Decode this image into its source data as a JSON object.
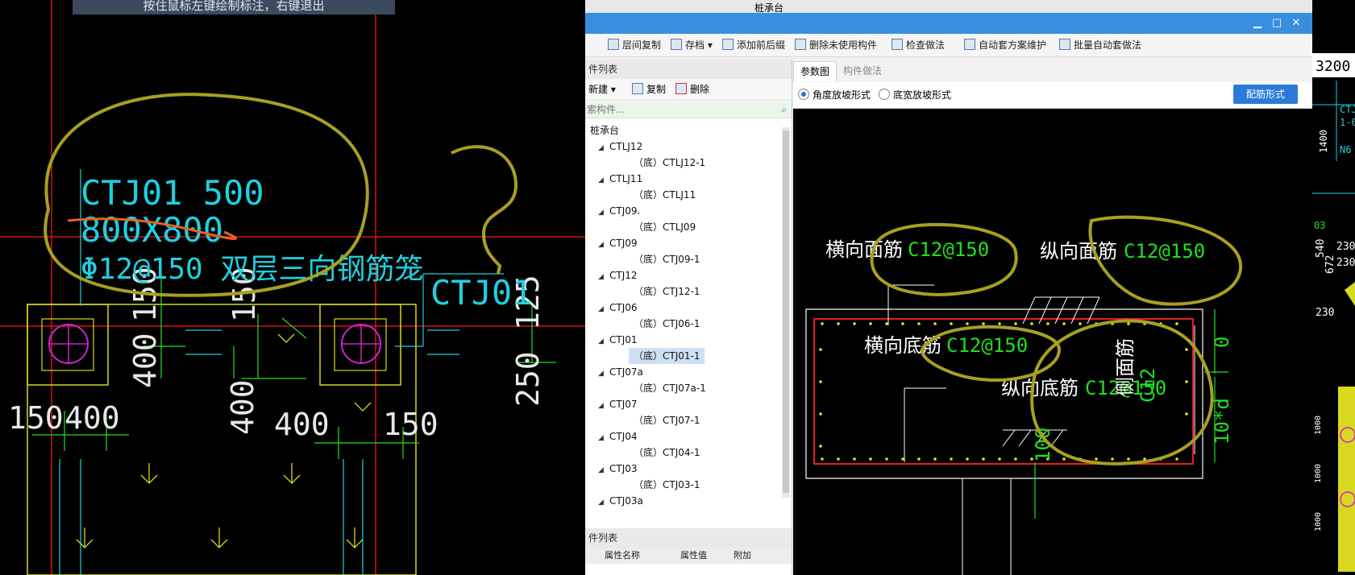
{
  "cad_left": {
    "hint": "按住鼠标左键绘制标注，右键退出",
    "annotation_line1": "CTJ01 500",
    "annotation_line2": "800X800",
    "annotation_line3": "Φ12@150 双层三向钢筋笼",
    "label_ctj01": "CTJ01",
    "dim_150a": "150",
    "dim_150b": "150",
    "dim_400a": "400",
    "dim_125": "125",
    "dim_250": "250",
    "dim_150c": "150",
    "dim_400b": "400",
    "dim_400c": "400",
    "dim_400d": "400",
    "dim_150d": "150"
  },
  "dialog": {
    "top_label": "桩承台",
    "toolbar": {
      "copy_floor": "层间复制",
      "save": "存档",
      "add_prefix": "添加前后缀",
      "delete_unused": "删除未使用构件",
      "check_method": "检查做法",
      "auto_plan": "自动套方案维护",
      "batch_auto": "批量自动套做法"
    },
    "component_list_title": "件列表",
    "new_label": "新建",
    "copy_label": "复制",
    "delete_label": "删除",
    "search_placeholder": "索构件...",
    "tree_root": "桩承台",
    "tree": [
      {
        "name": "CTLJ12",
        "child": "（底）CTLJ12-1"
      },
      {
        "name": "CTLJ11",
        "child": "（底）CTLJ11"
      },
      {
        "name": "CTJ09.",
        "child": "（底）CTLJ09"
      },
      {
        "name": "CTJ09",
        "child": "（底）CTJ09-1"
      },
      {
        "name": "CTJ12",
        "child": "（底）CTJ12-1"
      },
      {
        "name": "CTJ06",
        "child": "（底）CTJ06-1"
      },
      {
        "name": "CTJ01",
        "child": "（底）CTJ01-1"
      },
      {
        "name": "CTJ07a",
        "child": "（底）CTJ07a-1"
      },
      {
        "name": "CTJ07",
        "child": "（底）CTJ07-1"
      },
      {
        "name": "CTJ04",
        "child": "（底）CTJ04-1"
      },
      {
        "name": "CTJ03",
        "child": "（底）CTJ03-1"
      },
      {
        "name": "CTJ03a",
        "child": ""
      }
    ],
    "property_list_title": "件列表",
    "prop_col1": "属性名称",
    "prop_col2": "属性值",
    "prop_col3": "附加",
    "tab_param": "参数图",
    "tab_method": "构件做法",
    "radio_angle": "角度放坡形式",
    "radio_width": "底宽放坡形式",
    "rebar_button": "配筋形式",
    "diagram": {
      "h_top_label": "横向面筋",
      "h_top_val": "C12@150",
      "v_top_label": "纵向面筋",
      "v_top_val": "C12@150",
      "h_bot_label": "横向底筋",
      "h_bot_val": "C12@150",
      "v_bot_label": "纵向底筋",
      "v_bot_val": "C12@150",
      "side_label": "侧面筋",
      "side_val": "C12",
      "dim_0": "0",
      "dim_10d": "10*d",
      "dim_100": "100"
    }
  },
  "cad_right": {
    "dim_3200": "3200",
    "t1": "CTJ",
    "t2": "1-6",
    "t3": "N6",
    "t4": "1400",
    "t5": "03",
    "t6": "230",
    "t7": "540",
    "t8": "672",
    "t9": "230",
    "t10": "230"
  }
}
